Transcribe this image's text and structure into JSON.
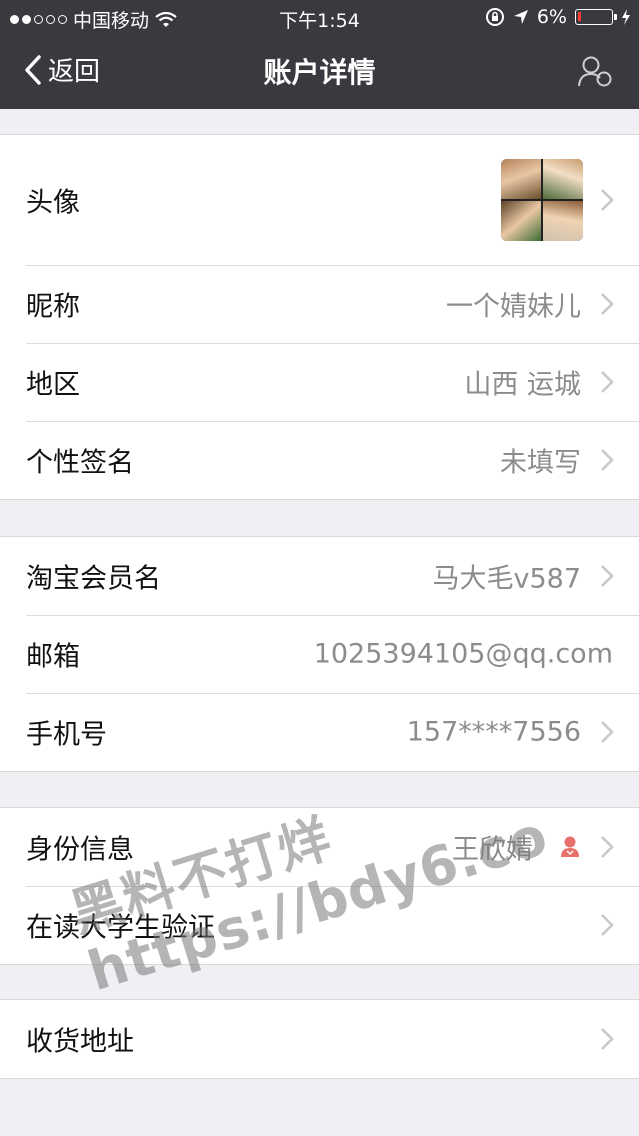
{
  "status_bar": {
    "carrier": "中国移动",
    "time": "下午1:54",
    "battery": "6%",
    "battery_level": 0.06
  },
  "nav": {
    "back_label": "返回",
    "title": "账户详情"
  },
  "profile": {
    "avatar_label": "头像",
    "nickname_label": "昵称",
    "nickname": "一个婧妹儿",
    "region_label": "地区",
    "region": "山西 运城",
    "signature_label": "个性签名",
    "signature": "未填写"
  },
  "account": {
    "taobao_label": "淘宝会员名",
    "taobao_name": "马大毛v587",
    "email_label": "邮箱",
    "email": "1025394105@qq.com",
    "phone_label": "手机号",
    "phone": "157****7556"
  },
  "identity": {
    "identity_label": "身份信息",
    "identity_name": "王欣婧",
    "student_label": "在读大学生验证"
  },
  "shipping": {
    "address_label": "收货地址"
  },
  "watermark": {
    "line1": "黑料不打烊",
    "line2": "https://bdy6.co"
  },
  "colors": {
    "nav_bg": "#393a3f",
    "page_bg": "#efeff4",
    "value_text": "#8c8c8c",
    "identity_icon": "#e8706a"
  },
  "icons": [
    "back-chevron-icon",
    "contacts-icon",
    "chevron-right-icon",
    "identity-verified-icon",
    "wifi-icon",
    "location-icon",
    "lock-rotation-icon",
    "charging-icon"
  ]
}
